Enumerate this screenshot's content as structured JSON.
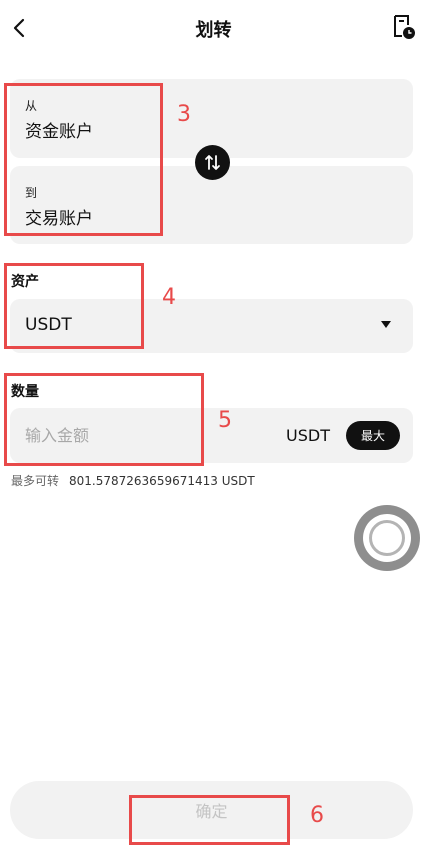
{
  "header": {
    "title": "划转",
    "back_icon": "chevron-left-icon",
    "history_icon": "document-clock-icon"
  },
  "transfer": {
    "from_label": "从",
    "from_account": "资金账户",
    "to_label": "到",
    "to_account": "交易账户",
    "swap_icon": "swap-vertical-icon"
  },
  "asset": {
    "label": "资产",
    "value": "USDT"
  },
  "amount": {
    "label": "数量",
    "placeholder": "输入金额",
    "unit": "USDT",
    "max_label": "最大"
  },
  "available": {
    "label": "最多可转",
    "value": "801.5787263659671413 USDT"
  },
  "confirm": {
    "label": "确定"
  },
  "annotations": [
    "3",
    "4",
    "5",
    "6"
  ],
  "colors": {
    "annotation": "#e84a4a",
    "card_bg": "#f2f2f2",
    "primary": "#111111"
  }
}
